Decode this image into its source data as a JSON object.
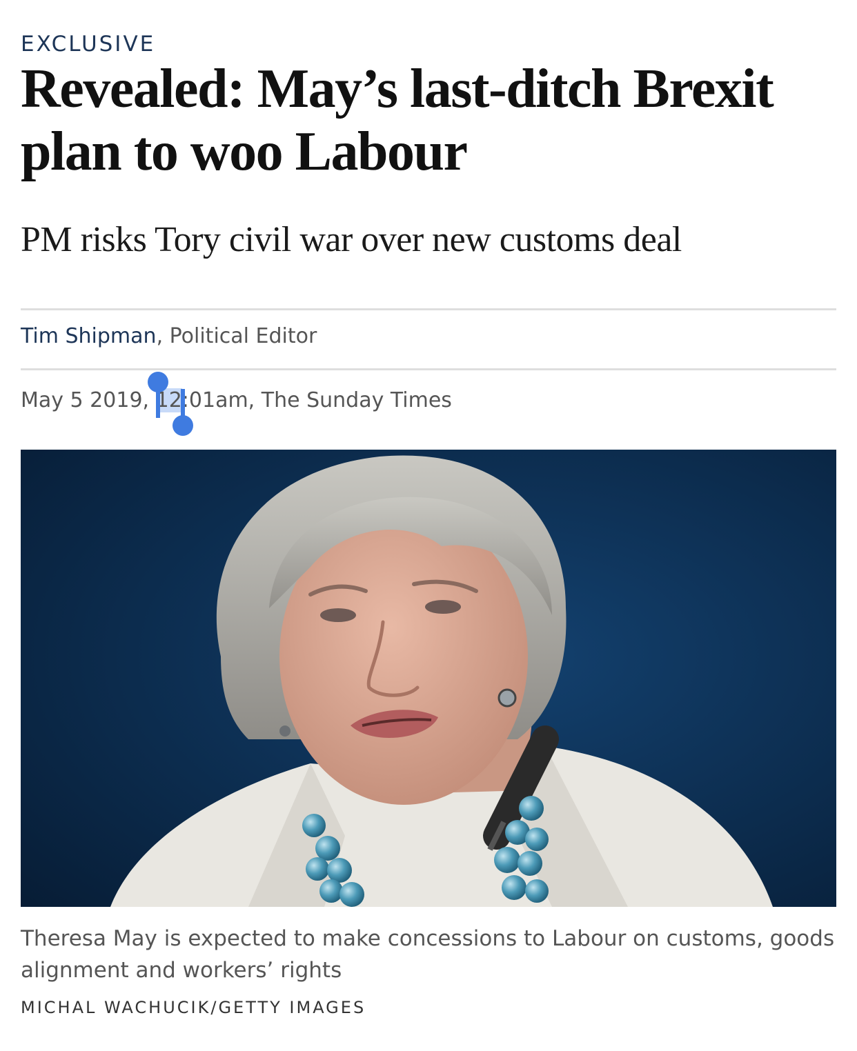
{
  "article": {
    "kicker": "EXCLUSIVE",
    "headline_line1": "Revealed: May’s last-ditch Brexit",
    "headline_line2": "plan to woo Labour",
    "standfirst": "PM risks Tory civil war over new customs deal",
    "byline": {
      "author": "Tim Shipman",
      "role": ", Political Editor"
    },
    "dateline": {
      "before_selection": "May 5 2019, ",
      "selected": "12",
      "after_selection": ":01am, The Sunday Times"
    },
    "image": {
      "icon": "portrait-photo",
      "background_color": "#0d2d52"
    },
    "caption": "Theresa May is expected to make concessions to Labour on customs, goods alignment and workers’ rights",
    "credit": "MICHAL WACHUCIK/GETTY IMAGES"
  },
  "colors": {
    "accent": "#1d3557",
    "selection": "#4a86e8",
    "text": "#111111",
    "muted": "#555555"
  }
}
